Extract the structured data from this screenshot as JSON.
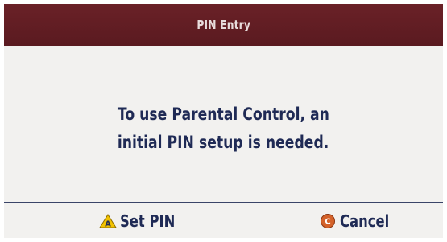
{
  "dialog": {
    "title": "PIN Entry",
    "message_lines": [
      "To use Parental Control, an",
      "initial PIN setup is needed."
    ]
  },
  "footer": {
    "set_pin": {
      "key_letter": "A",
      "icon": "triangle-a-button-icon",
      "label": "Set PIN"
    },
    "cancel": {
      "key_letter": "C",
      "icon": "circle-c-button-icon",
      "label": "Cancel"
    }
  },
  "colors": {
    "title_bar": "#621d24",
    "text": "#1f2a55",
    "background": "#f2f1ef",
    "triangle_icon": "#f2c200",
    "circle_icon": "#d4622a"
  }
}
